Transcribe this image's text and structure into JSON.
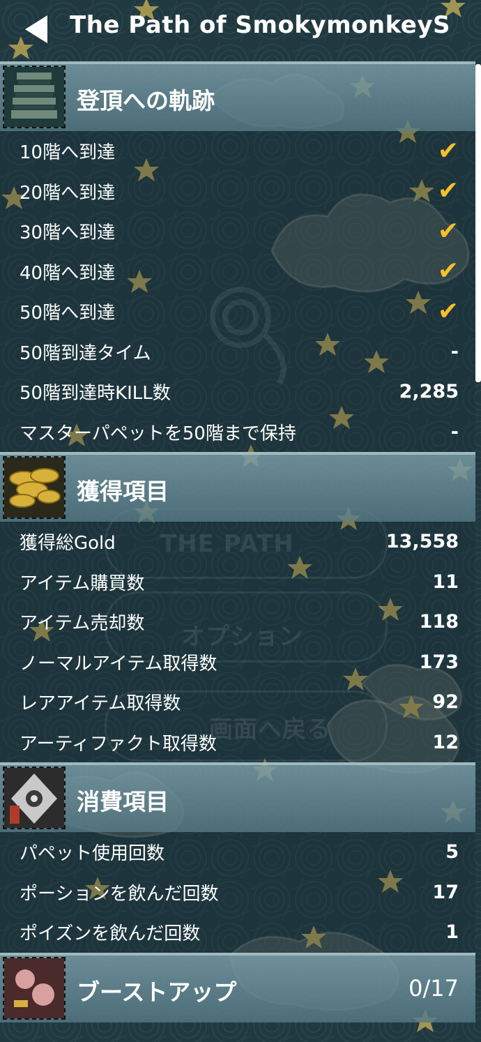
{
  "header": {
    "title": "The Path of SmokymonkeyS"
  },
  "background": {
    "bg_color": "#203941",
    "star_color": "#a99a55"
  },
  "ghost_menu": {
    "items": [
      "THE PATH",
      "オプション",
      "画面へ戻る"
    ]
  },
  "sections": [
    {
      "title": "登頂への軌跡",
      "icon": "tower-icon",
      "rows": [
        {
          "label": "10階へ到達",
          "check": true
        },
        {
          "label": "20階へ到達",
          "check": true
        },
        {
          "label": "30階へ到達",
          "check": true
        },
        {
          "label": "40階へ到達",
          "check": true
        },
        {
          "label": "50階へ到達",
          "check": true
        },
        {
          "label": "50階到達タイム",
          "value": "-"
        },
        {
          "label": "50階到達時KILL数",
          "value": "2,285"
        },
        {
          "label": "マスターパペットを50階まで保持",
          "value": "-"
        }
      ]
    },
    {
      "title": "獲得項目",
      "icon": "gold-coins-icon",
      "rows": [
        {
          "label": "獲得総Gold",
          "value": "13,558"
        },
        {
          "label": "アイテム購買数",
          "value": "11"
        },
        {
          "label": "アイテム売却数",
          "value": "118"
        },
        {
          "label": "ノーマルアイテム取得数",
          "value": "173"
        },
        {
          "label": "レアアイテム取得数",
          "value": "92"
        },
        {
          "label": "アーティファクト取得数",
          "value": "12"
        }
      ]
    },
    {
      "title": "消費項目",
      "icon": "puppet-icon",
      "rows": [
        {
          "label": "パペット使用回数",
          "value": "5"
        },
        {
          "label": "ポーションを飲んだ回数",
          "value": "17"
        },
        {
          "label": "ポイズンを飲んだ回数",
          "value": "1"
        }
      ]
    },
    {
      "title": "ブーストアップ",
      "icon": "boost-icon",
      "extra": "0/17",
      "rows": []
    }
  ],
  "check_glyph": "✔",
  "check_color": "#f5c02a"
}
